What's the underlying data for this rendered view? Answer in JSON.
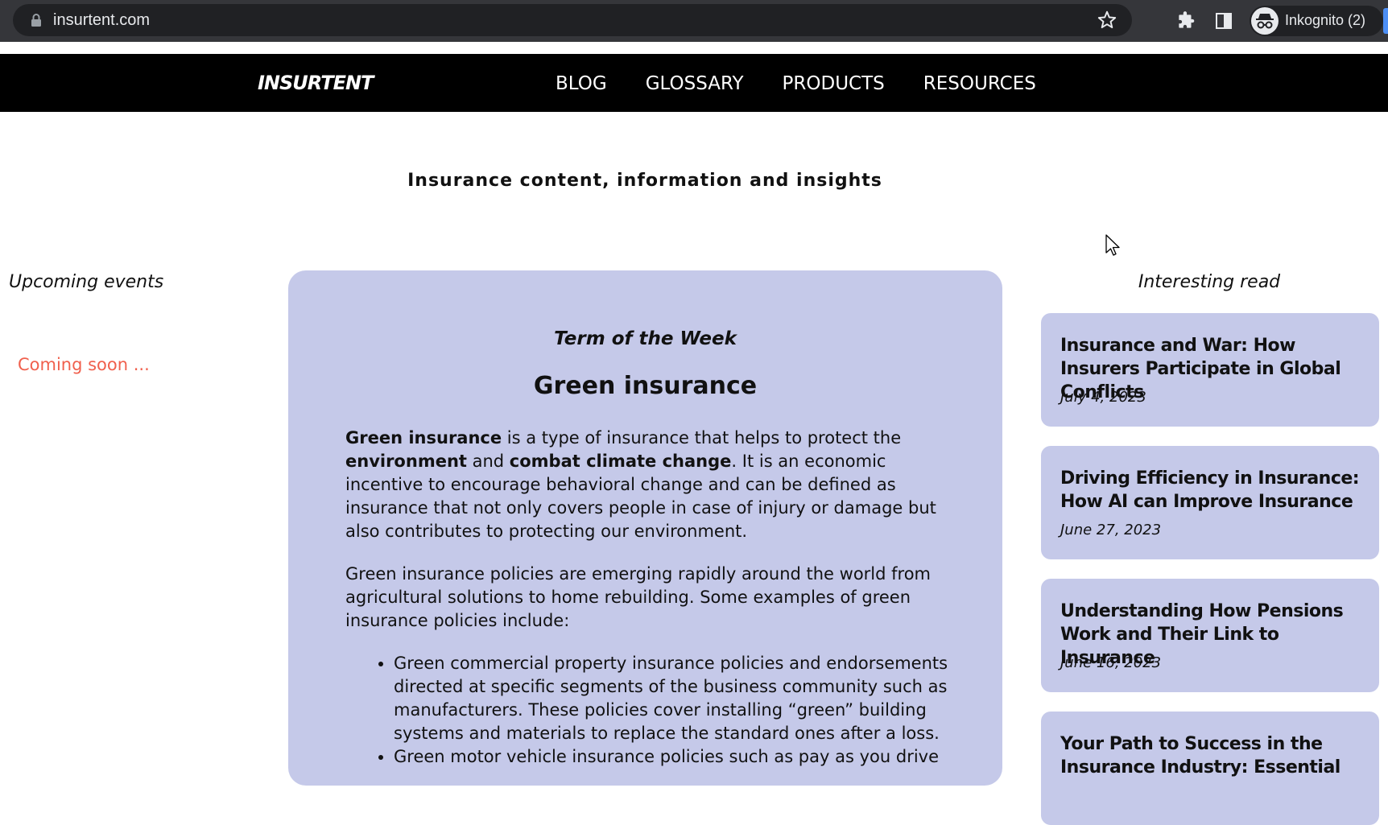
{
  "browser": {
    "url": "insurtent.com",
    "profile_label": "Inkognito (2)",
    "icons": [
      "lock-icon",
      "star-icon",
      "extensions-icon",
      "side-panel-icon",
      "incognito-icon"
    ]
  },
  "site": {
    "logo": "INSURTENT",
    "nav": [
      "BLOG",
      "GLOSSARY",
      "PRODUCTS",
      "RESOURCES"
    ],
    "tagline": "Insurance content, information and insights"
  },
  "events": {
    "title": "Upcoming events",
    "message": "Coming soon ..."
  },
  "term": {
    "kicker": "Term of the Week",
    "title": "Green insurance",
    "p1_bold1": "Green insurance",
    "p1_text1": " is a type of insurance that helps to protect the ",
    "p1_bold2": "environment",
    "p1_text2": " and ",
    "p1_bold3": "combat climate change",
    "p1_text3": ". It is an economic incentive to encourage behavioral change and can be defined as insurance that not only covers people in case of injury or damage but also contributes to protecting our environment.",
    "p2": "Green insurance policies are emerging rapidly around the world from agricultural solutions to home rebuilding. Some examples of green insurance policies include:",
    "bullets": [
      "Green commercial property insurance policies and endorsements directed at specific segments of the business community such as manufacturers. These policies cover installing “green” building systems and materials to replace the standard ones after a loss.",
      "Green motor vehicle insurance policies such as pay as you drive"
    ]
  },
  "reads": {
    "title": "Interesting read",
    "items": [
      {
        "title": "Insurance and War: How Insurers Participate in Global Conflicts",
        "date": "July 4, 2023"
      },
      {
        "title": "Driving Efficiency in Insurance: How AI can Improve Insurance",
        "date": "June 27, 2023"
      },
      {
        "title": "Understanding How Pensions Work and Their Link to Insurance",
        "date": "June 16, 2023"
      },
      {
        "title": "Your Path to Success in the Insurance Industry: Essential",
        "date": ""
      }
    ]
  },
  "colors": {
    "card_bg": "#c5c9e9",
    "coming_soon": "#f0604d",
    "nav_bg": "#000000",
    "chrome_bg": "#35363a"
  }
}
